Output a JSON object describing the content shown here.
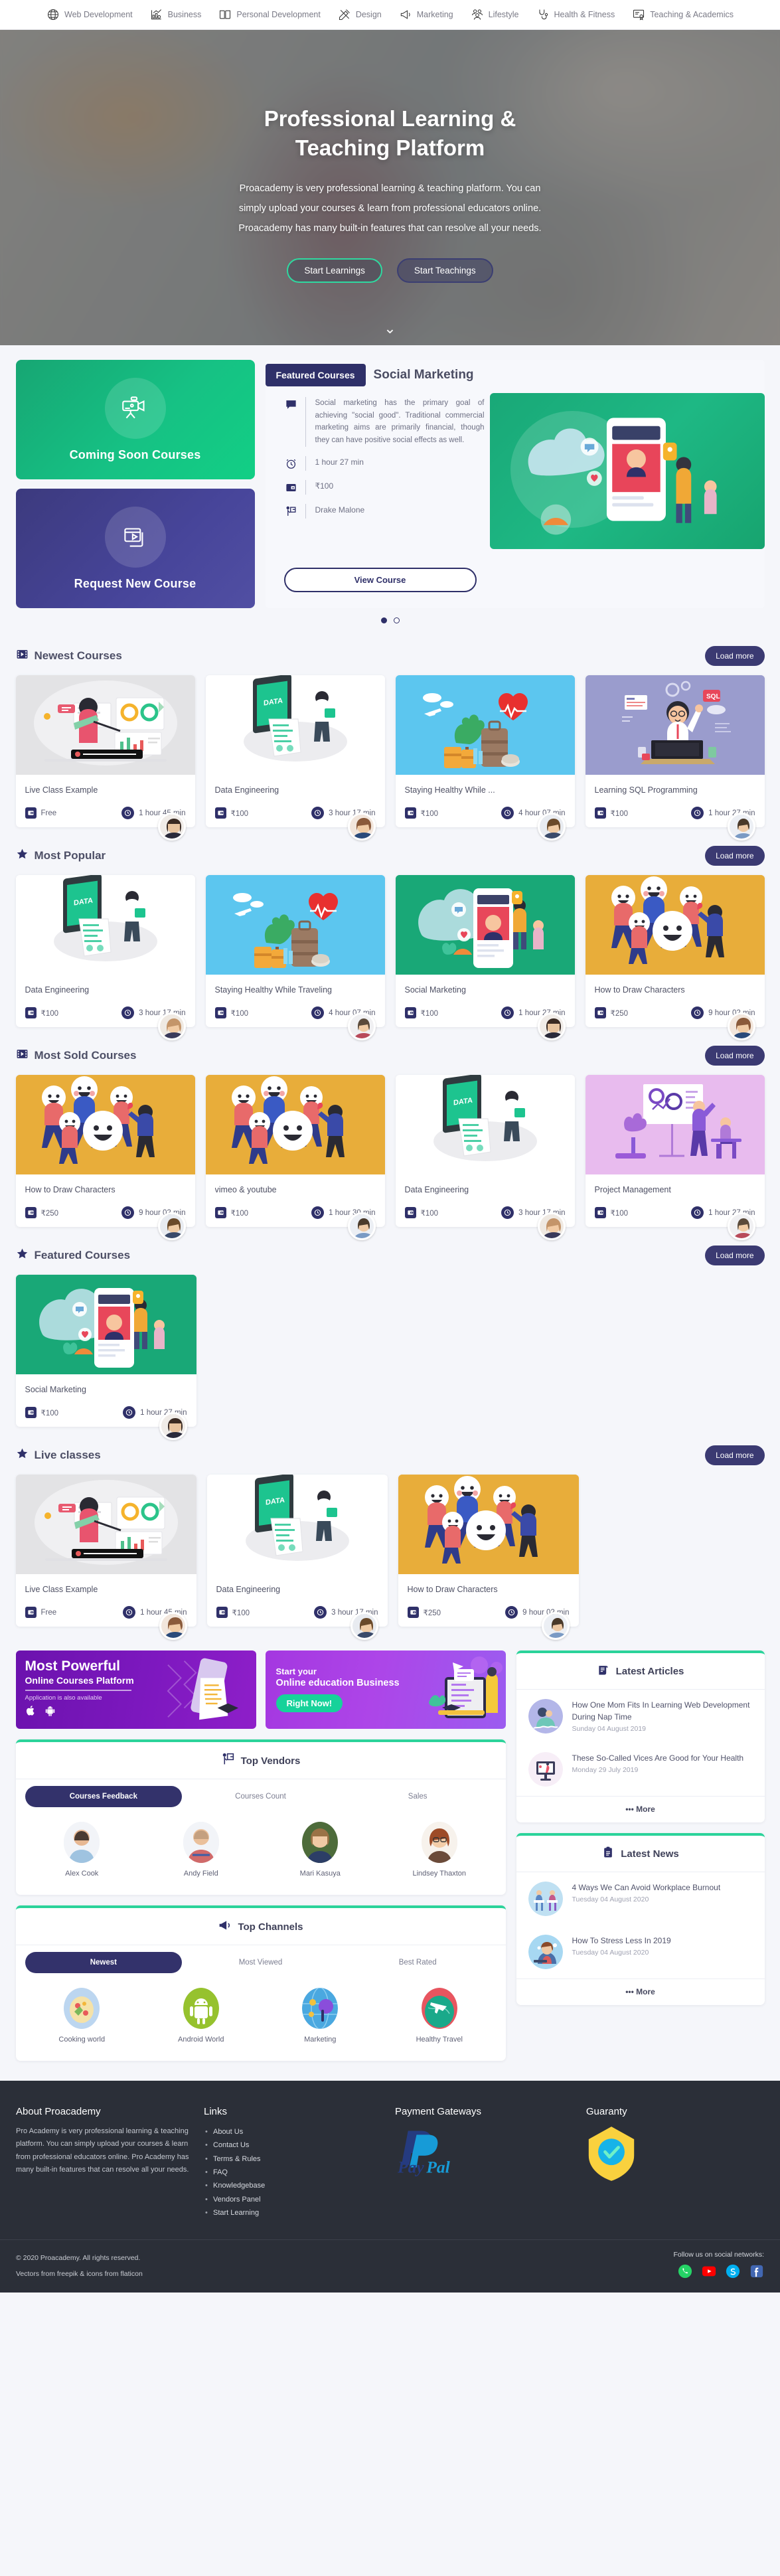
{
  "topbar": {
    "categories": [
      {
        "icon": "globe-icon",
        "label": "Web Development"
      },
      {
        "icon": "chart-business-icon",
        "label": "Business"
      },
      {
        "icon": "book-icon",
        "label": "Personal Development"
      },
      {
        "icon": "ruler-pencil-icon",
        "label": "Design"
      },
      {
        "icon": "megaphone-icon",
        "label": "Marketing"
      },
      {
        "icon": "people-icon",
        "label": "Lifestyle"
      },
      {
        "icon": "stethoscope-icon",
        "label": "Health & Fitness"
      },
      {
        "icon": "certificate-icon",
        "label": "Teaching & Academics"
      }
    ]
  },
  "hero": {
    "title_line1": "Professional Learning &",
    "title_line2": "Teaching Platform",
    "paragraph": "Proacademy is very professional learning & teaching platform. You can simply upload your courses & learn from professional educators online. Proacademy has many built-in features that can resolve all your needs.",
    "btn_learn": "Start Learnings",
    "btn_teach": "Start Teachings",
    "scroll_icon": "chevron-down-icon"
  },
  "promos": [
    {
      "label": "Coming Soon Courses",
      "icon": "video-camera-icon",
      "color": "#17bd80"
    },
    {
      "label": "Request New Course",
      "icon": "video-player-icon",
      "color": "#45439a"
    }
  ],
  "featured": {
    "tag": "Featured Courses",
    "course_title": "Social Marketing",
    "description": "Social marketing has the primary goal of achieving \"social good\". Traditional commercial marketing aims are primarily financial, though they can have positive social effects as well.",
    "duration": "1 hour 27 min",
    "price": "₹100",
    "instructor": "Drake Malone",
    "view_button": "View Course",
    "dots": [
      "active",
      "inactive"
    ]
  },
  "sections": [
    {
      "id": "newest",
      "icon": "film-icon",
      "title": "Newest Courses",
      "load_more": "Load more",
      "courses": [
        {
          "name": "Live Class Example",
          "price": "Free",
          "duration": "1 hour 45 min",
          "thumb": "live-class",
          "bg": "#e3e3e5"
        },
        {
          "name": "Data Engineering",
          "price": "₹100",
          "duration": "3 hour 17 min",
          "thumb": "data-eng",
          "bg": "#ffffff"
        },
        {
          "name": "Staying Healthy While ...",
          "price": "₹100",
          "duration": "4 hour 07 min",
          "thumb": "travel",
          "bg": "#5cc6ef"
        },
        {
          "name": "Learning SQL Programming",
          "price": "₹100",
          "duration": "1 hour 27 min",
          "thumb": "sql",
          "bg": "#9a9ccd"
        }
      ]
    },
    {
      "id": "popular",
      "icon": "star-icon",
      "title": "Most Popular",
      "load_more": "Load more",
      "courses": [
        {
          "name": "Data Engineering",
          "price": "₹100",
          "duration": "3 hour 17 min",
          "thumb": "data-eng",
          "bg": "#ffffff"
        },
        {
          "name": "Staying Healthy While Traveling",
          "price": "₹100",
          "duration": "4 hour 07 min",
          "thumb": "travel",
          "bg": "#5cc6ef"
        },
        {
          "name": "Social Marketing",
          "price": "₹100",
          "duration": "1 hour 27 min",
          "thumb": "social",
          "bg": "#19a877"
        },
        {
          "name": "How to Draw Characters",
          "price": "₹250",
          "duration": "9 hour 02 min",
          "thumb": "characters",
          "bg": "#e8ad3a"
        }
      ]
    },
    {
      "id": "sold",
      "icon": "film-icon",
      "title": "Most Sold Courses",
      "load_more": "Load more",
      "courses": [
        {
          "name": "How to Draw Characters",
          "price": "₹250",
          "duration": "9 hour 02 min",
          "thumb": "characters",
          "bg": "#e8ad3a"
        },
        {
          "name": "vimeo & youtube",
          "price": "₹100",
          "duration": "1 hour 30 min",
          "thumb": "characters",
          "bg": "#e8ad3a"
        },
        {
          "name": "Data Engineering",
          "price": "₹100",
          "duration": "3 hour 17 min",
          "thumb": "data-eng",
          "bg": "#ffffff"
        },
        {
          "name": "Project Management",
          "price": "₹100",
          "duration": "1 hour 27 min",
          "thumb": "project",
          "bg": "#e8bbee"
        }
      ]
    },
    {
      "id": "featuredsec",
      "icon": "star-icon",
      "title": "Featured Courses",
      "load_more": "Load more",
      "courses": [
        {
          "name": "Social Marketing",
          "price": "₹100",
          "duration": "1 hour 27 min",
          "thumb": "social",
          "bg": "#19a877"
        }
      ]
    },
    {
      "id": "live",
      "icon": "star-icon",
      "title": "Live classes",
      "load_more": "Load more",
      "courses": [
        {
          "name": "Live Class Example",
          "price": "Free",
          "duration": "1 hour 45 min",
          "thumb": "live-class",
          "bg": "#e3e3e5"
        },
        {
          "name": "Data Engineering",
          "price": "₹100",
          "duration": "3 hour 17 min",
          "thumb": "data-eng",
          "bg": "#ffffff"
        },
        {
          "name": "How to Draw Characters",
          "price": "₹250",
          "duration": "9 hour 02 min",
          "thumb": "characters",
          "bg": "#e8ad3a"
        }
      ]
    }
  ],
  "banners": {
    "left": {
      "line1": "Most Powerful",
      "line2": "Online Courses Platform",
      "line3": "Application is also available",
      "icons": [
        "apple-icon",
        "android-icon"
      ]
    },
    "right": {
      "line1": "Start your",
      "line2": "Online education Business",
      "cta": "Right Now!"
    }
  },
  "top_vendors": {
    "title": "Top Vendors",
    "icon": "presenter-icon",
    "tabs": [
      {
        "label": "Courses Feedback",
        "active": true
      },
      {
        "label": "Courses Count",
        "active": false
      },
      {
        "label": "Sales",
        "active": false
      }
    ],
    "people": [
      {
        "name": "Alex Cook",
        "tone": "#9fc3e0"
      },
      {
        "name": "Andy Field",
        "tone": "#d06a6a"
      },
      {
        "name": "Mari Kasuya",
        "tone": "#4d6b3a"
      },
      {
        "name": "Lindsey Thaxton",
        "tone": "#b08b6d"
      }
    ]
  },
  "top_channels": {
    "title": "Top Channels",
    "icon": "megaphone-icon",
    "tabs": [
      {
        "label": "Newest",
        "active": true
      },
      {
        "label": "Most Viewed",
        "active": false
      },
      {
        "label": "Best Rated",
        "active": false
      }
    ],
    "channels": [
      {
        "name": "Cooking world",
        "tone": "#bcd6f0"
      },
      {
        "name": "Android World",
        "tone": "#96c22e"
      },
      {
        "name": "Marketing",
        "tone": "#4aa8e0"
      },
      {
        "name": "Healthy Travel",
        "tone": "#e8555f"
      }
    ]
  },
  "latest_articles": {
    "title": "Latest Articles",
    "icon": "scroll-icon",
    "more": "More",
    "more_icon": "ellipsis-icon",
    "items": [
      {
        "title": "How One Mom Fits In Learning Web Development During Nap Time",
        "date": "Sunday 04 August 2019",
        "tone": "#b3b6e8"
      },
      {
        "title": "These So-Called Vices Are Good for Your Health",
        "date": "Monday 29 July 2019",
        "tone": "#f2e6f2"
      }
    ]
  },
  "latest_news": {
    "title": "Latest News",
    "icon": "clipboard-icon",
    "more": "More",
    "more_icon": "ellipsis-icon",
    "items": [
      {
        "title": "4 Ways We Can Avoid Workplace Burnout",
        "date": "Tuesday 04 August 2020",
        "tone": "#bfe0f2"
      },
      {
        "title": "How To Stress Less In 2019",
        "date": "Tuesday 04 August 2020",
        "tone": "#a7d8f2"
      }
    ]
  },
  "footer": {
    "about_title": "About Proacademy",
    "about_text": "Pro Academy is very professional learning & teaching platform. You can simply upload your courses & learn from professional educators online. Pro Academy has many built-in features that can resolve all your needs.",
    "links_title": "Links",
    "links": [
      "About Us",
      "Contact Us",
      "Terms & Rules",
      "FAQ",
      "Knowledgebase",
      "Vendors Panel",
      "Start Learning"
    ],
    "payment_title": "Payment Gateways",
    "payment_logo": "paypal-logo",
    "guaranty_title": "Guaranty",
    "guaranty_icon": "shield-check-icon",
    "copyright_line1": "© 2020 Proacademy. All rights reserved.",
    "copyright_line2": "Vectors from freepik & icons from flaticon",
    "social_label": "Follow us on social networks:",
    "socials": [
      "whatsapp-icon",
      "youtube-icon",
      "skype-icon",
      "facebook-icon"
    ]
  }
}
